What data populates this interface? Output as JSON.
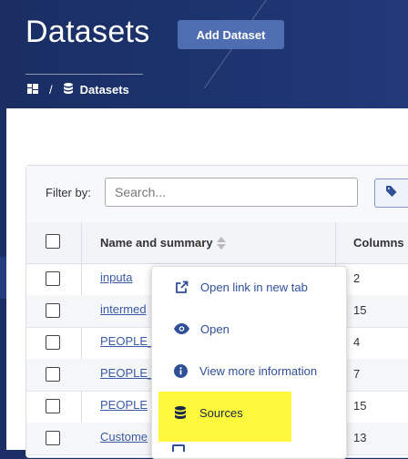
{
  "header": {
    "title": "Datasets",
    "add_button": "Add Dataset",
    "breadcrumb": {
      "separator": "/",
      "current": "Datasets"
    }
  },
  "filter": {
    "label": "Filter by:",
    "placeholder": "Search..."
  },
  "table": {
    "columns": {
      "name": "Name and summary",
      "columns": "Columns"
    },
    "rows": [
      {
        "name": "inputa",
        "columns": "2"
      },
      {
        "name": "intermed",
        "columns": "15"
      },
      {
        "name": "PEOPLE_",
        "columns": "4"
      },
      {
        "name": "PEOPLE_",
        "columns": "7"
      },
      {
        "name": "PEOPLE",
        "columns": "15"
      },
      {
        "name": "Custome",
        "columns": "13"
      }
    ]
  },
  "context_menu": {
    "items": [
      {
        "label": "Open link in new tab",
        "icon": "external-link-icon"
      },
      {
        "label": "Open",
        "icon": "eye-icon"
      },
      {
        "label": "View more information",
        "icon": "info-icon"
      },
      {
        "label": "Sources",
        "icon": "database-icon"
      }
    ],
    "highlight_color": "#fdf83b"
  },
  "colors": {
    "brand_dark": "#1b2f66",
    "accent": "#4f6db1",
    "link": "#3b5aa6"
  }
}
